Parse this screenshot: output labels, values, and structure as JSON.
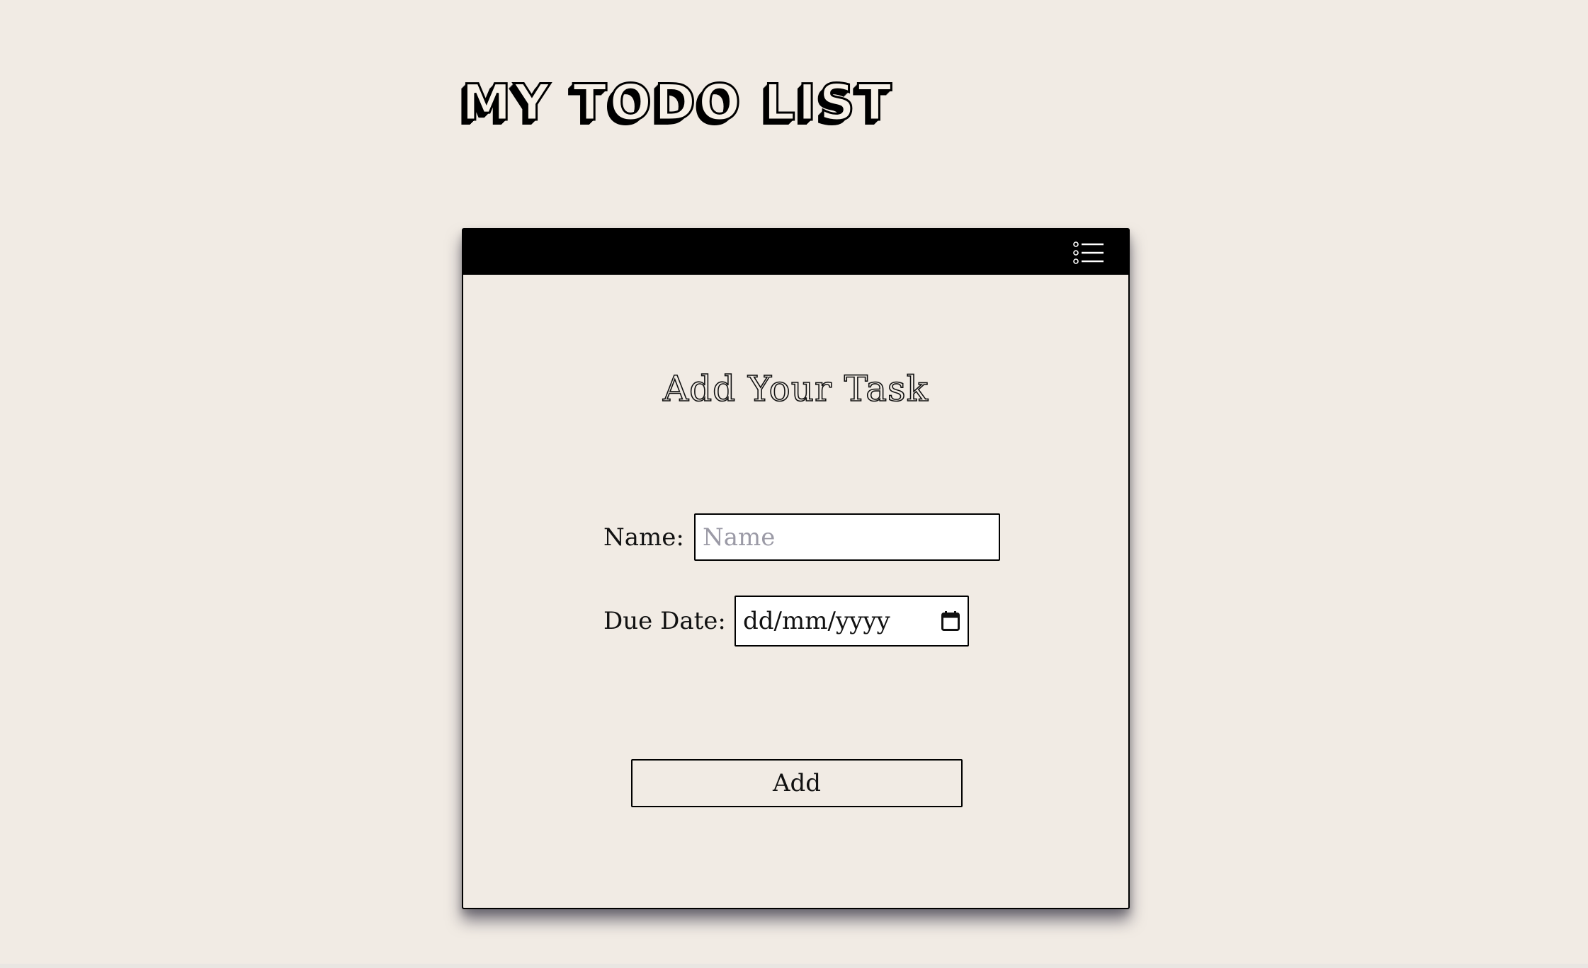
{
  "page": {
    "title": "MY TODO LIST",
    "background_color": "#f1ebe4"
  },
  "card": {
    "header_icon": "list-menu-icon",
    "form_title": "Add Your Task",
    "fields": {
      "name": {
        "label": "Name:",
        "placeholder": "Name",
        "value": ""
      },
      "due_date": {
        "label": "Due Date:",
        "display_value": "dd/mm/yyyy",
        "icon": "calendar-icon"
      }
    },
    "submit_label": "Add"
  }
}
